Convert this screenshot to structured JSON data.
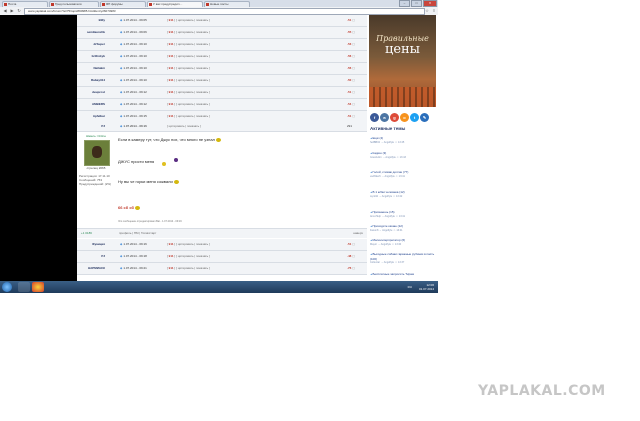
{
  "browser": {
    "tabs": [
      "Почта",
      "Тред пользователя",
      "ЯП форумы",
      "У вас предупредил…",
      "Новые посты"
    ],
    "active_tab_index": 3,
    "url": "www.yaplakal.com/forum7/st/75/topic890985.html#entry26074983"
  },
  "rows_top": [
    {
      "nick": "Billy",
      "date": "1.07.2014 - 09:05",
      "num": "911",
      "acts": "цитировать | показать",
      "rate": "-51"
    },
    {
      "nick": "semilaunchk",
      "date": "1.07.2014 - 09:06",
      "num": "911",
      "acts": "цитировать | показать",
      "rate": "-55"
    },
    {
      "nick": "drSuper",
      "date": "1.07.2014 - 09:10",
      "num": "911",
      "acts": "цитировать | показать",
      "rate": "-53"
    },
    {
      "nick": "brillisbyb",
      "date": "1.07.2014 - 09:10",
      "num": "911",
      "acts": "цитировать | показать",
      "rate": "-56"
    },
    {
      "nick": "Neilakm",
      "date": "1.07.2014 - 09:10",
      "num": "911",
      "acts": "цитировать | показать",
      "rate": "-56"
    },
    {
      "nick": "Rabay314",
      "date": "1.07.2014 - 09:10",
      "num": "911",
      "acts": "цитировать | показать",
      "rate": "-50"
    },
    {
      "nick": "deuprost",
      "date": "1.07.2014 - 09:12",
      "num": "911",
      "acts": "цитировать | показать",
      "rate": "-51"
    },
    {
      "nick": "AMBERS",
      "date": "1.07.2014 - 09:12",
      "num": "911",
      "acts": "цитировать | показать",
      "rate": "-54"
    },
    {
      "nick": "Apfelbar",
      "date": "1.07.2014 - 09:15",
      "num": "911",
      "acts": "цитировать | показать",
      "rate": "-51"
    }
  ],
  "post": {
    "nick": "PJ",
    "date": "1.07.2014 - 09:16",
    "acts": "цитировать | показать",
    "rate": "291",
    "user_status": "Шмель: Online",
    "avatar_caption": "стрелец 2065",
    "user_info": "Регистрация: 17.11.10\nСообщений: 753\nПредупреждений: (2%)",
    "line1": "Если в камеру тут, что Джус пох, что много не узнал",
    "line2": "ДЖУС прости меня",
    "line3": "Ну вы че горки меня сожвали",
    "line4": "66 сб сб",
    "edited": "Это сообщение отредактировал Bat - 1.07.2014 - 09:19",
    "footer_rep": "+1 0186",
    "footer_links": "профиль | ПМ | Топикстарт",
    "footer_top": "наверх"
  },
  "rows_bottom": [
    {
      "nick": "Функция",
      "date": "1.07.2014 - 09:16",
      "num": "911",
      "acts": "цитировать | показать",
      "rate": "-51"
    },
    {
      "nick": "PJ",
      "date": "1.07.2014 - 09:18",
      "num": "911",
      "acts": "цитировать | показать",
      "rate": "-48"
    },
    {
      "nick": "НАРМИАСК",
      "date": "1.07.2014 - 09:21",
      "num": "911",
      "acts": "цитировать | показать",
      "rate": "-76"
    }
  ],
  "sidebar": {
    "banner_line1": "Правильные",
    "banner_line2": "цены",
    "social_icons": [
      "facebook-icon",
      "vk-icon",
      "google-plus-icon",
      "odnoklassniki-icon",
      "twitter-icon",
      "livejournal-icon"
    ],
    "social_colors": [
      "#3b5998",
      "#4c75a3",
      "#dd4b39",
      "#f7931e",
      "#1da1f2",
      "#2a6ebb"
    ],
    "topics_title": "Активные темы",
    "topics": [
      {
        "title": "Ещё (4)",
        "meta": "hellBB02 → Angolfyle ☺ 13:45"
      },
      {
        "title": "Кадиш (3)",
        "meta": "Grew1Aim → Angolfyle ☺ 13:43"
      },
      {
        "title": "Голой, словак долгие (77)",
        "meta": "vedfliker6 → Angolfyle ☺ 13:41"
      },
      {
        "title": "В 1 юбки человека (12)",
        "meta": "wyrd42 → Angolfyle ☺ 13:42"
      },
      {
        "title": "Признаешь (15)",
        "meta": "AnxoHelp → Angolfyle ☺ 13:41"
      },
      {
        "title": "Приходите качаю (12)",
        "meta": "Faxon8 → Angolfyle ☺ 13:41"
      },
      {
        "title": "Малоинтерпретатор (6)",
        "meta": "Mayor → Angolfyle ☺ 13:40"
      },
      {
        "title": "Выгодные собаки гаражные рубинки в пасть (100)",
        "meta": "Collentar → Angolfyle ☺ 13:37"
      },
      {
        "title": "Бесплатные запросить Тираж",
        "meta": ""
      }
    ]
  },
  "taskbar": {
    "time": "12:06",
    "date": "01.07.2014",
    "lang": "RU"
  },
  "watermark": "YAPLAKAL.COM"
}
